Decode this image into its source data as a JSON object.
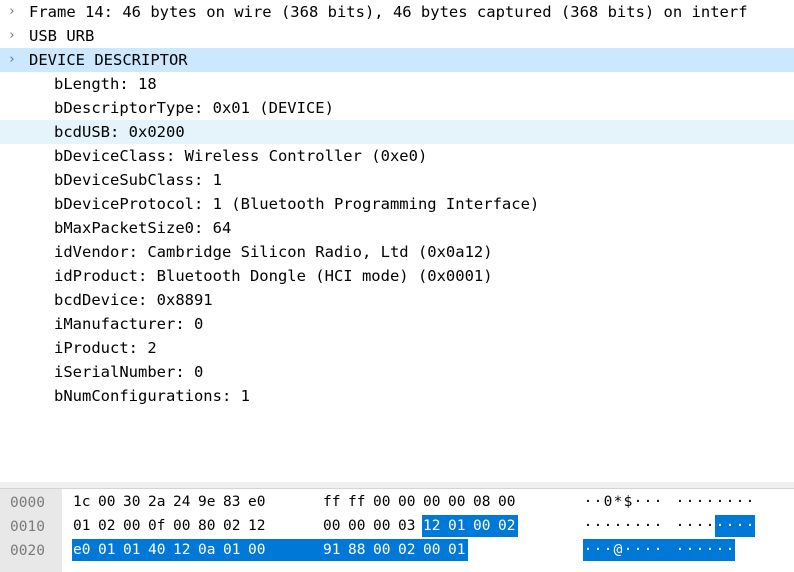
{
  "tree": [
    {
      "level": 0,
      "expander": ">",
      "text": "Frame 14: 46 bytes on wire (368 bits), 46 bytes captured (368 bits) on interf",
      "state": ""
    },
    {
      "level": 0,
      "expander": ">",
      "text": "USB URB",
      "state": ""
    },
    {
      "level": 0,
      "expander": "v",
      "text": "DEVICE DESCRIPTOR",
      "state": "hl"
    },
    {
      "level": 1,
      "expander": "",
      "text": "bLength: 18",
      "state": ""
    },
    {
      "level": 1,
      "expander": "",
      "text": "bDescriptorType: 0x01 (DEVICE)",
      "state": ""
    },
    {
      "level": 1,
      "expander": "",
      "text": "bcdUSB: 0x0200",
      "state": "sel"
    },
    {
      "level": 1,
      "expander": "",
      "text": "bDeviceClass: Wireless Controller (0xe0)",
      "state": ""
    },
    {
      "level": 1,
      "expander": "",
      "text": "bDeviceSubClass: 1",
      "state": ""
    },
    {
      "level": 1,
      "expander": "",
      "text": "bDeviceProtocol: 1 (Bluetooth Programming Interface)",
      "state": ""
    },
    {
      "level": 1,
      "expander": "",
      "text": "bMaxPacketSize0: 64",
      "state": ""
    },
    {
      "level": 1,
      "expander": "",
      "text": "idVendor: Cambridge Silicon Radio, Ltd (0x0a12)",
      "state": ""
    },
    {
      "level": 1,
      "expander": "",
      "text": "idProduct: Bluetooth Dongle (HCI mode) (0x0001)",
      "state": ""
    },
    {
      "level": 1,
      "expander": "",
      "text": "bcdDevice: 0x8891",
      "state": ""
    },
    {
      "level": 1,
      "expander": "",
      "text": "iManufacturer: 0",
      "state": ""
    },
    {
      "level": 1,
      "expander": "",
      "text": "iProduct: 2",
      "state": ""
    },
    {
      "level": 1,
      "expander": "",
      "text": "iSerialNumber: 0",
      "state": ""
    },
    {
      "level": 1,
      "expander": "",
      "text": "bNumConfigurations: 1",
      "state": ""
    }
  ],
  "hex": [
    {
      "offset": "0000",
      "bytes": [
        "1c",
        "00",
        "30",
        "2a",
        "24",
        "9e",
        "83",
        "e0",
        "ff",
        "ff",
        "00",
        "00",
        "00",
        "00",
        "08",
        "00"
      ],
      "ascii": [
        "·",
        "·",
        "0",
        "*",
        "$",
        "·",
        "·",
        "·",
        "·",
        "·",
        "·",
        "·",
        "·",
        "·",
        "·",
        "·"
      ],
      "selected": [
        false,
        false,
        false,
        false,
        false,
        false,
        false,
        false,
        false,
        false,
        false,
        false,
        false,
        false,
        false,
        false
      ]
    },
    {
      "offset": "0010",
      "bytes": [
        "01",
        "02",
        "00",
        "0f",
        "00",
        "80",
        "02",
        "12",
        "00",
        "00",
        "00",
        "03",
        "12",
        "01",
        "00",
        "02"
      ],
      "ascii": [
        "·",
        "·",
        "·",
        "·",
        "·",
        "·",
        "·",
        "·",
        "·",
        "·",
        "·",
        "·",
        "·",
        "·",
        "·",
        "·"
      ],
      "selected": [
        false,
        false,
        false,
        false,
        false,
        false,
        false,
        false,
        false,
        false,
        false,
        false,
        true,
        true,
        true,
        true
      ]
    },
    {
      "offset": "0020",
      "bytes": [
        "e0",
        "01",
        "01",
        "40",
        "12",
        "0a",
        "01",
        "00",
        "91",
        "88",
        "00",
        "02",
        "00",
        "01"
      ],
      "ascii": [
        "·",
        "·",
        "·",
        "@",
        "·",
        "·",
        "·",
        "·",
        "·",
        "·",
        "·",
        "·",
        "·",
        "·"
      ],
      "selected": [
        true,
        true,
        true,
        true,
        true,
        true,
        true,
        true,
        true,
        true,
        true,
        true,
        true,
        true
      ]
    }
  ],
  "colors": {
    "selection": "#0078d7",
    "row_highlight": "#cce8ff",
    "row_hover": "#e5f3fb"
  }
}
